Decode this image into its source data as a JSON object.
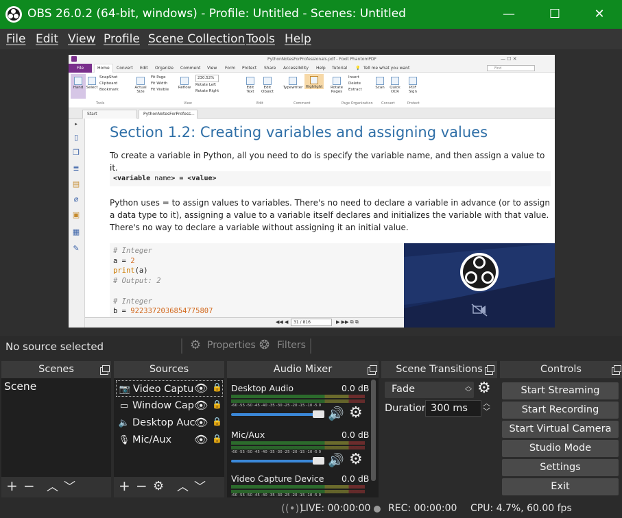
{
  "window": {
    "title": "OBS 26.0.2 (64-bit, windows) - Profile: Untitled - Scenes: Untitled",
    "minimize_glyph": "—",
    "maximize_glyph": "☐",
    "close_glyph": "✕"
  },
  "menu": [
    "File",
    "Edit",
    "View",
    "Profile",
    "Scene Collection",
    "Tools",
    "Help"
  ],
  "preview": {
    "foxit": {
      "window_title": "PythonNotesForProfessionals.pdf - Foxit PhantomPDF",
      "file_tab": "File",
      "tabs": [
        "Home",
        "Convert",
        "Edit",
        "Organize",
        "Comment",
        "View",
        "Form",
        "Protect",
        "Share",
        "Accessibility",
        "Help",
        "Tutorial"
      ],
      "tell_me": "Tell me what you want",
      "find_placeholder": "Find",
      "ribbon": {
        "hand": "Hand",
        "select": "Select",
        "snapshot": "SnapShot",
        "clipboard": "Clipboard",
        "bookmark": "Bookmark",
        "actual_size": "Actual Size",
        "fit_page": "Fit Page",
        "fit_width": "Fit Width",
        "fit_visible": "Fit Visible",
        "reflow": "Reflow",
        "zoom": "230.52%",
        "rotate_left": "Rotate Left",
        "rotate_right": "Rotate Right",
        "edit_text": "Edit Text",
        "edit_object": "Edit Object",
        "typewriter": "Typewriter",
        "highlight": "Highlight",
        "rotate_pages": "Rotate Pages",
        "insert": "Insert",
        "delete": "Delete",
        "extract": "Extract",
        "scan": "Scan",
        "quick_ocr": "Quick OCR",
        "pdf_sign": "PDF Sign",
        "groups": [
          "Tools",
          "View",
          "Edit",
          "Comment",
          "Page Organization",
          "Convert",
          "Protect"
        ]
      },
      "doc_tabs": [
        "Start",
        "PythonNotesForProfess..."
      ],
      "page_indicator": "31 / 816"
    },
    "document": {
      "heading": "Section 1.2: Creating variables and assigning values",
      "para1": "To create a variable in Python, all you need to do is specify the variable name, and then assign a value to it.",
      "code_a": "<variable",
      "code_b": "name",
      "code_c": "> = <value>",
      "para2": "Python uses = to assign values to variables. There's no need to declare a variable in advance (or to assign a data type to it), assigning a value to a variable itself declares and initializes the variable with that value. There's no way to declare a variable without assigning it an initial value.",
      "code_lines": {
        "l1": "# Integer",
        "l2a": "a = ",
        "l2b": "2",
        "l3a": "print",
        "l3b": "(a)",
        "l4": "# Output: 2",
        "l6": "# Integer",
        "l7a": "b = ",
        "l7b": "9223372036854775807"
      }
    }
  },
  "source_bar": {
    "no_source": "No source selected",
    "properties": "Properties",
    "filters": "Filters"
  },
  "scenes": {
    "title": "Scenes",
    "items": [
      "Scene"
    ]
  },
  "sources": {
    "title": "Sources",
    "items": [
      "Video Captu",
      "Window Cap",
      "Desktop Auc",
      "Mic/Aux"
    ]
  },
  "mixer": {
    "title": "Audio Mixer",
    "ticks": "-60 -55 -50 -45 -40 -35 -30 -25 -20 -15 -10 -5 0",
    "channels": [
      {
        "name": "Desktop Audio",
        "db": "0.0 dB"
      },
      {
        "name": "Mic/Aux",
        "db": "0.0 dB"
      },
      {
        "name": "Video Capture Device",
        "db": "0.0 dB"
      }
    ]
  },
  "transitions": {
    "title": "Scene Transitions",
    "selected": "Fade",
    "duration_label": "Duration",
    "duration_value": "300 ms"
  },
  "controls": {
    "title": "Controls",
    "buttons": [
      "Start Streaming",
      "Start Recording",
      "Start Virtual Camera",
      "Studio Mode",
      "Settings",
      "Exit"
    ]
  },
  "status": {
    "live": "LIVE: 00:00:00",
    "rec": "REC: 00:00:00",
    "cpu": "CPU: 4.7%, 60.00 fps"
  },
  "colors": {
    "titlebar": "#0e8a1f",
    "accent": "#3b88d8",
    "heading_blue": "#2f6fa7",
    "foxit_purple": "#7a2f8c"
  }
}
